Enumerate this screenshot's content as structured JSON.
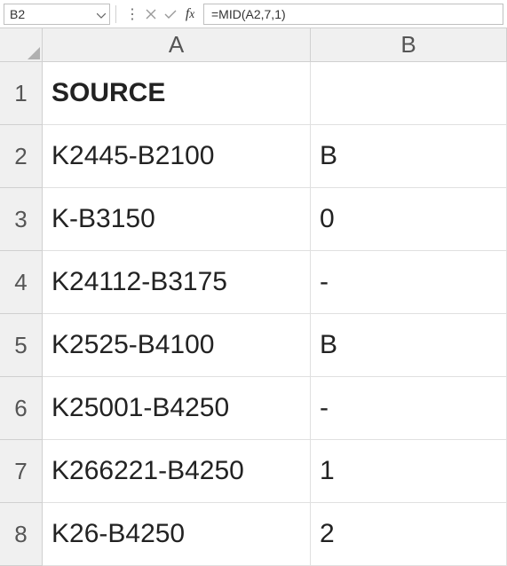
{
  "formula_bar": {
    "name_box": "B2",
    "formula": "=MID(A2,7,1)"
  },
  "columns": [
    "A",
    "B"
  ],
  "rows": [
    {
      "num": "1",
      "a": "SOURCE",
      "b": "",
      "bold": true
    },
    {
      "num": "2",
      "a": "K2445-B2100",
      "b": "B",
      "bold": false
    },
    {
      "num": "3",
      "a": "K-B3150",
      "b": "0",
      "bold": false
    },
    {
      "num": "4",
      "a": "K24112-B3175",
      "b": "-",
      "bold": false
    },
    {
      "num": "5",
      "a": "K2525-B4100",
      "b": "B",
      "bold": false
    },
    {
      "num": "6",
      "a": "K25001-B4250",
      "b": "-",
      "bold": false
    },
    {
      "num": "7",
      "a": "K266221-B4250",
      "b": "1",
      "bold": false
    },
    {
      "num": "8",
      "a": "K26-B4250",
      "b": "2",
      "bold": false
    }
  ],
  "chart_data": {
    "type": "table",
    "title": "",
    "columns": [
      "SOURCE",
      ""
    ],
    "rows": [
      [
        "K2445-B2100",
        "B"
      ],
      [
        "K-B3150",
        "0"
      ],
      [
        "K24112-B3175",
        "-"
      ],
      [
        "K2525-B4100",
        "B"
      ],
      [
        "K25001-B4250",
        "-"
      ],
      [
        "K266221-B4250",
        "1"
      ],
      [
        "K26-B4250",
        "2"
      ]
    ]
  }
}
